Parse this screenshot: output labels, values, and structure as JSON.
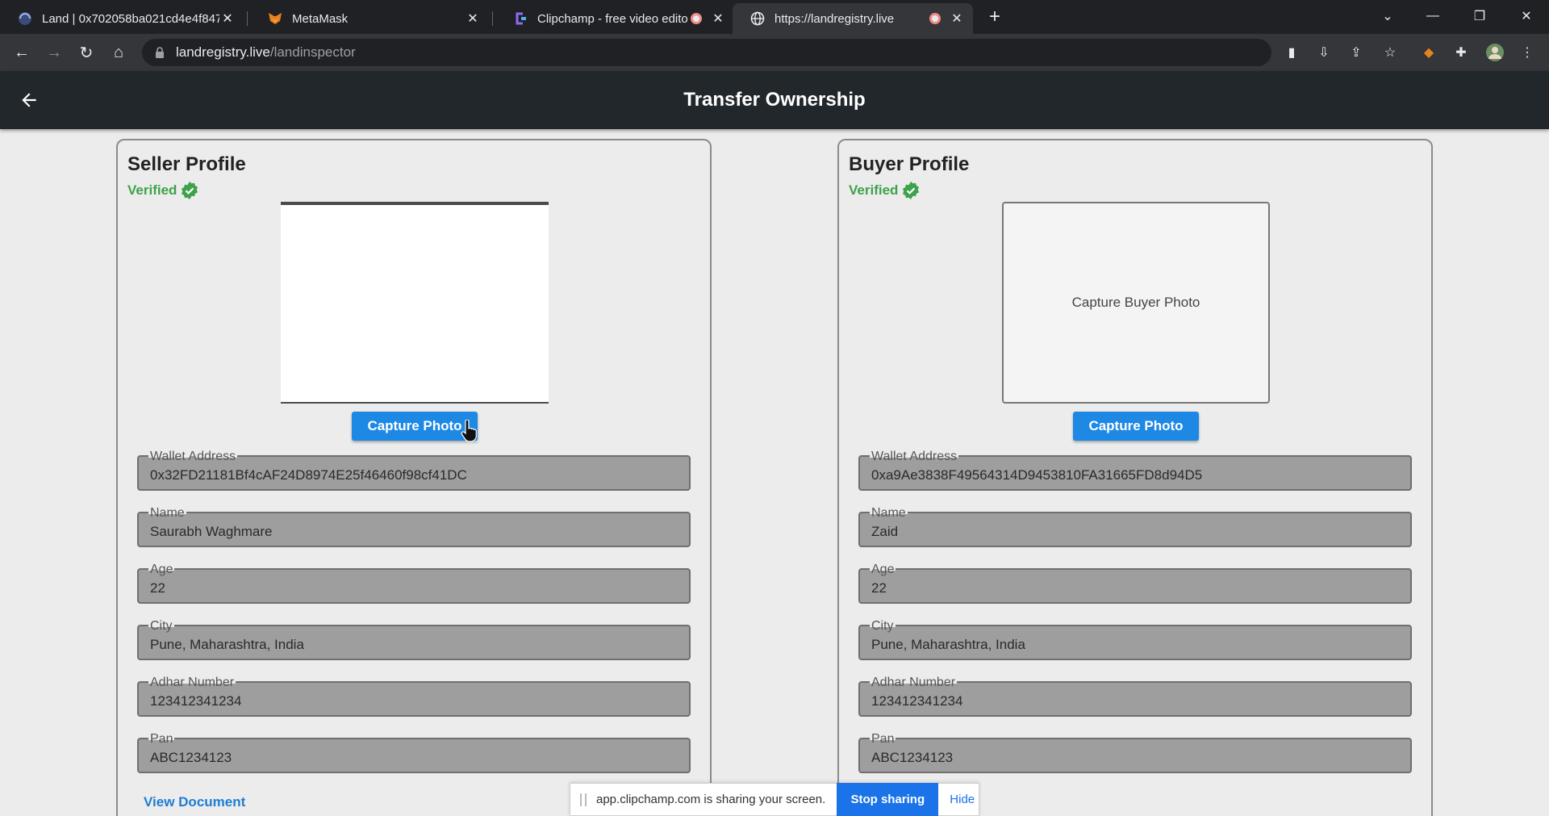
{
  "browser": {
    "tabs": [
      {
        "title": "Land | 0x702058ba021cd4e4f847",
        "icon": "land-globe-icon",
        "active": false
      },
      {
        "title": "MetaMask",
        "icon": "metamask-fox-icon",
        "active": false
      },
      {
        "title": "Clipchamp - free video edito",
        "icon": "clipchamp-icon",
        "active": false,
        "recording": true
      },
      {
        "title": "https://landregistry.live",
        "icon": "globe-icon",
        "active": true,
        "recording": true
      }
    ],
    "new_tab_label": "+",
    "url_domain": "landregistry.live",
    "url_path": "/landinspector"
  },
  "app": {
    "title": "Transfer Ownership",
    "seller": {
      "heading": "Seller Profile",
      "verified_label": "Verified",
      "capture_button": "Capture Photo",
      "fields": {
        "wallet": {
          "label": "Wallet Address",
          "value": "0x32FD21181Bf4cAF24D8974E25f46460f98cf41DC"
        },
        "name": {
          "label": "Name",
          "value": "Saurabh Waghmare"
        },
        "age": {
          "label": "Age",
          "value": "22"
        },
        "city": {
          "label": "City",
          "value": "Pune, Maharashtra, India"
        },
        "adhar": {
          "label": "Adhar Number",
          "value": "123412341234"
        },
        "pan": {
          "label": "Pan",
          "value": "ABC1234123"
        }
      },
      "view_document": "View Document"
    },
    "buyer": {
      "heading": "Buyer Profile",
      "verified_label": "Verified",
      "photo_placeholder": "Capture Buyer Photo",
      "capture_button": "Capture Photo",
      "fields": {
        "wallet": {
          "label": "Wallet Address",
          "value": "0xa9Ae3838F49564314D9453810FA31665FD8d94D5"
        },
        "name": {
          "label": "Name",
          "value": "Zaid"
        },
        "age": {
          "label": "Age",
          "value": "22"
        },
        "city": {
          "label": "City",
          "value": "Pune, Maharashtra, India"
        },
        "adhar": {
          "label": "Adhar Number",
          "value": "123412341234"
        },
        "pan": {
          "label": "Pan",
          "value": "ABC1234123"
        }
      }
    }
  },
  "share_bar": {
    "message": "app.clipchamp.com is sharing your screen.",
    "stop_label": "Stop sharing",
    "hide_label": "Hide"
  },
  "colors": {
    "appbar": "#22272b",
    "primary_button": "#1e88e5",
    "verified_green": "#3da24a",
    "field_bg": "#9e9e9e"
  }
}
